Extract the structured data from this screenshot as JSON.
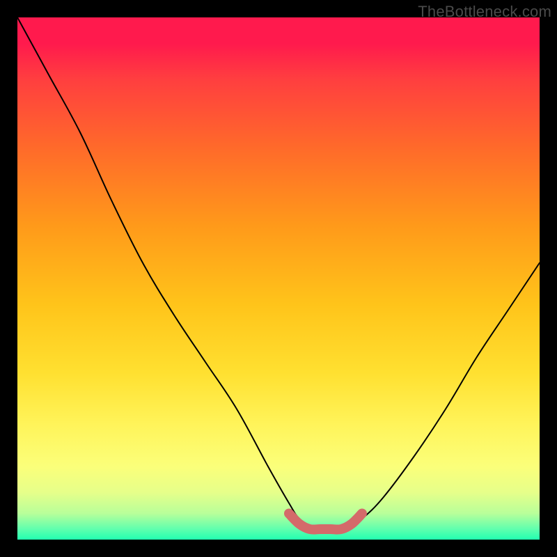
{
  "watermark": "TheBottleneck.com",
  "chart_data": {
    "type": "line",
    "title": "",
    "xlabel": "",
    "ylabel": "",
    "xlim": [
      0,
      100
    ],
    "ylim": [
      0,
      100
    ],
    "grid": false,
    "series": [
      {
        "name": "black-curve",
        "color": "#000000",
        "x": [
          0,
          6,
          12,
          18,
          24,
          30,
          36,
          42,
          48,
          52,
          54,
          57,
          60,
          63,
          66,
          70,
          76,
          82,
          88,
          94,
          100
        ],
        "y": [
          100,
          89,
          78,
          65,
          53,
          43,
          34,
          25,
          14,
          7,
          4,
          2,
          2,
          2,
          4,
          8,
          16,
          25,
          35,
          44,
          53
        ]
      },
      {
        "name": "trough-highlight",
        "color": "#d46a6a",
        "x": [
          52,
          54,
          56,
          58,
          60,
          62,
          64,
          66
        ],
        "y": [
          5,
          3,
          2,
          2,
          2,
          2,
          3,
          5
        ]
      }
    ],
    "annotations": []
  }
}
